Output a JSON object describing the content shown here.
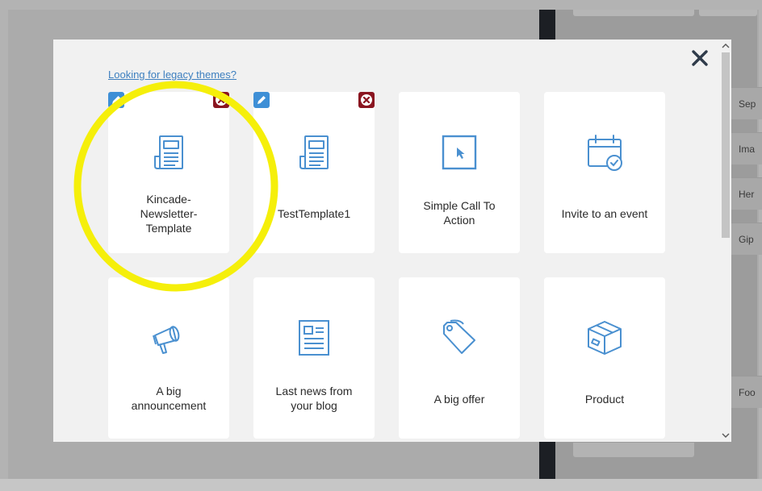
{
  "modal": {
    "legacy_link": "Looking for legacy themes?",
    "close_glyph": "✕"
  },
  "templates": [
    {
      "label": "Kincade-\nNewsletter-\nTemplate",
      "icon": "newspaper-icon",
      "editable": true
    },
    {
      "label": "TestTemplate1",
      "icon": "newspaper-icon",
      "editable": true
    },
    {
      "label": "Simple Call To\nAction",
      "icon": "cursor-square-icon",
      "editable": false
    },
    {
      "label": "Invite to an event",
      "icon": "calendar-check-icon",
      "editable": false
    },
    {
      "label": "A big\nannouncement",
      "icon": "megaphone-icon",
      "editable": false
    },
    {
      "label": "Last news from\nyour blog",
      "icon": "document-list-icon",
      "editable": false
    },
    {
      "label": "A big offer",
      "icon": "price-tag-icon",
      "editable": false
    },
    {
      "label": "Product",
      "icon": "box-icon",
      "editable": false
    }
  ],
  "background_sidebar": [
    {
      "label": "Sep"
    },
    {
      "label": "Ima"
    },
    {
      "label": "Her"
    },
    {
      "label": "Gip"
    },
    {
      "label": "Foo"
    }
  ],
  "colors": {
    "icon_blue": "#4a90d0",
    "edit_badge": "#3e8fd6",
    "delete_badge": "#8a1520",
    "annotation_yellow": "#f5ef0a"
  }
}
